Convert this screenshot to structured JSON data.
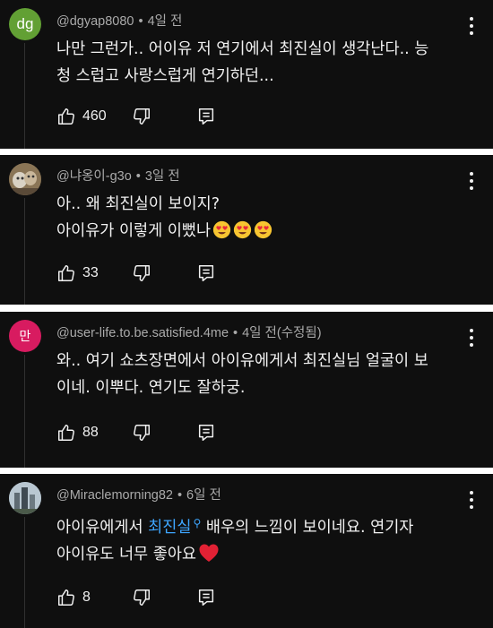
{
  "comments": [
    {
      "author": "@dgyap8080",
      "time": "4일 전",
      "avatar_text": "dg",
      "avatar_color": "#62a034",
      "lines": [
        "나만 그런가.. 어이유 저 연기에서 최진실이 생각난다.. 능",
        "청 스럽고 사랑스럽게 연기하던..."
      ],
      "likes": "460"
    },
    {
      "author": "@냐옹이-g3o",
      "time": "3일 전",
      "lines": [
        "아.. 왜 최진실이 보이지?",
        "아이유가 이렇게 이뻤나"
      ],
      "likes": "33"
    },
    {
      "author": "@user-life.to.be.satisfied.4me",
      "time": "4일 전(수정됨)",
      "avatar_text": "만",
      "avatar_color": "#d81b60",
      "lines": [
        "와.. 여기 쇼츠장면에서 아이유에게서 최진실님 얼굴이 보",
        "이네. 이뿌다. 연기도 잘하궁."
      ],
      "likes": "88"
    },
    {
      "author": "@Miraclemorning82",
      "time": "6일 전",
      "line1_before": "아이유에게서 ",
      "line1_link": "최진실",
      "line1_after": " 배우의 느낌이 보이네요. 연기자",
      "line2": "아이유도 너무 좋아요",
      "likes": "8"
    }
  ],
  "icons": [
    "like-icon",
    "dislike-icon",
    "reply-icon",
    "more-icon"
  ]
}
